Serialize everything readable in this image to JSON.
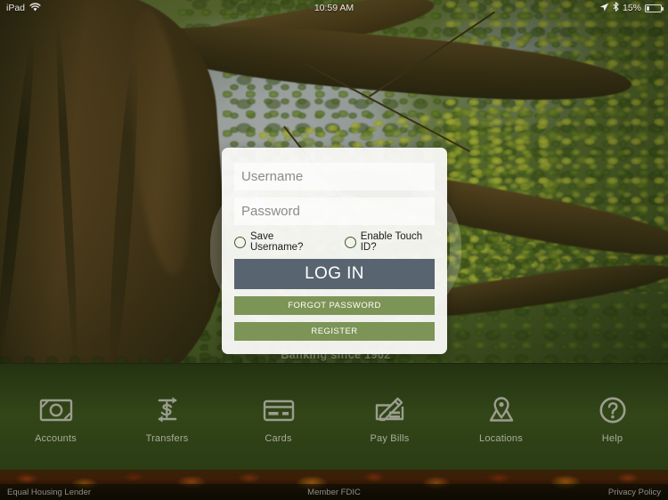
{
  "status_bar": {
    "device": "iPad",
    "wifi_icon": "wifi-icon",
    "time": "10:59 AM",
    "location_icon": "location-arrow-icon",
    "bluetooth_icon": "bluetooth-icon",
    "battery_percent": "15%",
    "battery_level": 15
  },
  "branding": {
    "tagline": "Banking since 1902",
    "watermark_icon": "bank-logo-watermark"
  },
  "login": {
    "username_placeholder": "Username",
    "username_value": "",
    "password_placeholder": "Password",
    "password_value": "",
    "save_username_label": "Save Username?",
    "save_username_checked": false,
    "enable_touch_id_label": "Enable Touch ID?",
    "enable_touch_id_checked": false,
    "login_label": "LOG IN",
    "forgot_password_label": "FORGOT PASSWORD",
    "register_label": "REGISTER"
  },
  "nav": {
    "items": [
      {
        "label": "Accounts",
        "icon": "money-bill-icon"
      },
      {
        "label": "Transfers",
        "icon": "transfer-arrows-dollar-icon"
      },
      {
        "label": "Cards",
        "icon": "credit-card-icon"
      },
      {
        "label": "Pay Bills",
        "icon": "check-pencil-icon"
      },
      {
        "label": "Locations",
        "icon": "map-pin-icon"
      },
      {
        "label": "Help",
        "icon": "question-circle-icon"
      }
    ]
  },
  "footer": {
    "left": "Equal Housing Lender",
    "center": "Member FDIC",
    "right": "Privacy Policy"
  },
  "colors": {
    "login_button": "#58646f",
    "action_button": "#7c9556",
    "nav_background": "#324618",
    "nav_label": "#a9ab9c",
    "card_background": "#fafaf8",
    "radio_outline": "#3e5b2c"
  }
}
